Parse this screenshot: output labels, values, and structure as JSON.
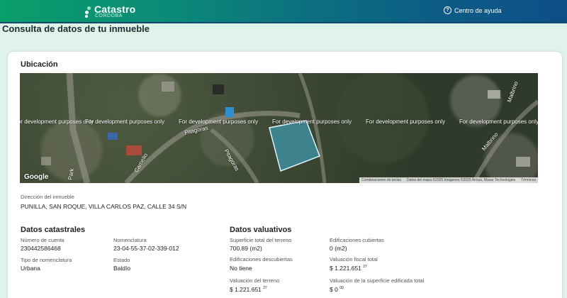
{
  "header": {
    "logo_main": "Catastro",
    "logo_sub": "CÓRDOBA",
    "help_icon_glyph": "?",
    "help_label": "Centro de ayuda"
  },
  "page": {
    "title": "Consulta de datos de tu inmueble"
  },
  "location": {
    "title": "Ubicación",
    "map": {
      "watermark": "For development purposes only",
      "streets": [
        "Pitagoras",
        "Pitagoras",
        "Carnelio",
        "Malbrino",
        "Malbrino",
        "Park"
      ],
      "google": "Google",
      "attribution": [
        "Combinaciones de teclas",
        "Datos del mapa ©2025 Imágenes ©2025 Airbus, Maxar Technologies",
        "Términos"
      ]
    },
    "address_label": "Dirección del inmueble",
    "address_value": "PUNILLA, SAN ROQUE, VILLA CARLOS PAZ, CALLE 34 S/N"
  },
  "cadastral": {
    "title": "Datos catastrales",
    "account_label": "Número de cuenta",
    "account_value": "230442586468",
    "nomenclature_label": "Nomenclatura",
    "nomenclature_value": "23-04-55-37-02-339-012",
    "nomenclature_type_label": "Tipo de nomenclatura",
    "nomenclature_type_value": "Urbana",
    "state_label": "Estado",
    "state_value": "Baldío"
  },
  "valuation": {
    "title": "Datos valuativos",
    "land_area_label": "Superficie total del terreno",
    "land_area_value": "700.89 (m2)",
    "covered_label": "Edificaciones cubiertas",
    "covered_value": "0 (m2)",
    "uncovered_label": "Edificaciones descubiertas",
    "uncovered_value": "No tiene",
    "fiscal_label": "Valuación fiscal total",
    "fiscal_value": "$ 1.221.651",
    "fiscal_cents": "27",
    "land_value_label": "Valuación del terreno",
    "land_value_value": "$ 1.221.651",
    "land_value_cents": "27",
    "built_value_label": "Valuación de la superficie edificada total",
    "built_value_value": "$ 0",
    "built_value_cents": "00"
  }
}
